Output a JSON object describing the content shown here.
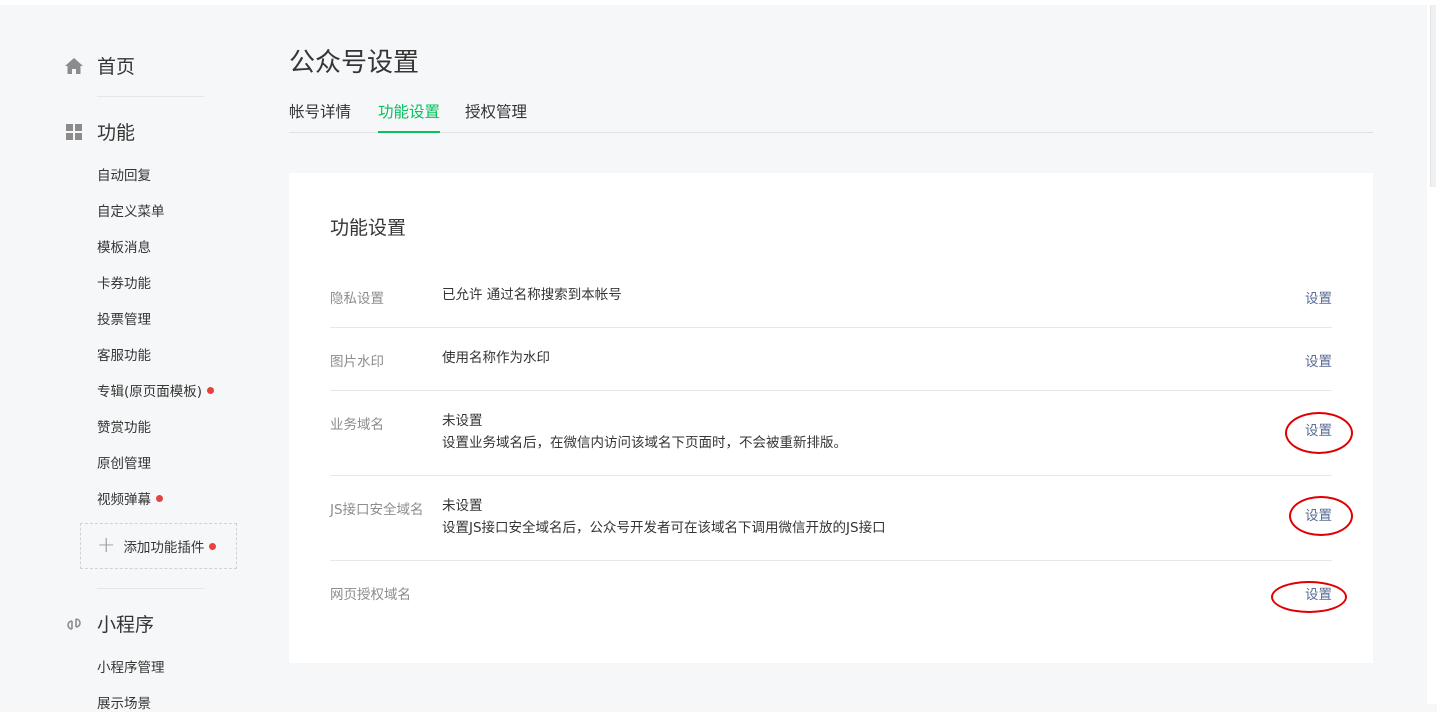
{
  "sidebar": {
    "home": {
      "label": "首页",
      "icon": "home-icon"
    },
    "features": {
      "label": "功能",
      "icon": "grid-icon",
      "items": [
        {
          "label": "自动回复",
          "dot": false
        },
        {
          "label": "自定义菜单",
          "dot": false
        },
        {
          "label": "模板消息",
          "dot": false
        },
        {
          "label": "卡券功能",
          "dot": false
        },
        {
          "label": "投票管理",
          "dot": false
        },
        {
          "label": "客服功能",
          "dot": false
        },
        {
          "label": "专辑(原页面模板)",
          "dot": true
        },
        {
          "label": "赞赏功能",
          "dot": false
        },
        {
          "label": "原创管理",
          "dot": false
        },
        {
          "label": "视频弹幕",
          "dot": true
        }
      ],
      "add_plugin_label": "添加功能插件"
    },
    "miniprogram": {
      "label": "小程序",
      "icon": "link-icon",
      "items": [
        {
          "label": "小程序管理"
        },
        {
          "label": "展示场景"
        }
      ]
    }
  },
  "header": {
    "title": "公众号设置",
    "tabs": [
      {
        "label": "帐号详情",
        "active": false
      },
      {
        "label": "功能设置",
        "active": true
      },
      {
        "label": "授权管理",
        "active": false
      }
    ]
  },
  "card": {
    "title": "功能设置",
    "rows": [
      {
        "label": "隐私设置",
        "status": "已允许 通过名称搜索到本帐号",
        "desc": "",
        "action": "设置",
        "highlighted": false
      },
      {
        "label": "图片水印",
        "status": "使用名称作为水印",
        "desc": "",
        "action": "设置",
        "highlighted": false
      },
      {
        "label": "业务域名",
        "status": "未设置",
        "desc": "设置业务域名后，在微信内访问该域名下页面时，不会被重新排版。",
        "action": "设置",
        "highlighted": true
      },
      {
        "label": "JS接口安全域名",
        "status": "未设置",
        "desc": "设置JS接口安全域名后，公众号开发者可在该域名下调用微信开放的JS接口",
        "action": "设置",
        "highlighted": true
      },
      {
        "label": "网页授权域名",
        "status": "",
        "desc": "",
        "action": "设置",
        "highlighted": true
      }
    ]
  },
  "colors": {
    "accent_green": "#07c160",
    "link_blue": "#576b95",
    "badge_red": "#e64340",
    "annotation_red": "#e00000"
  }
}
